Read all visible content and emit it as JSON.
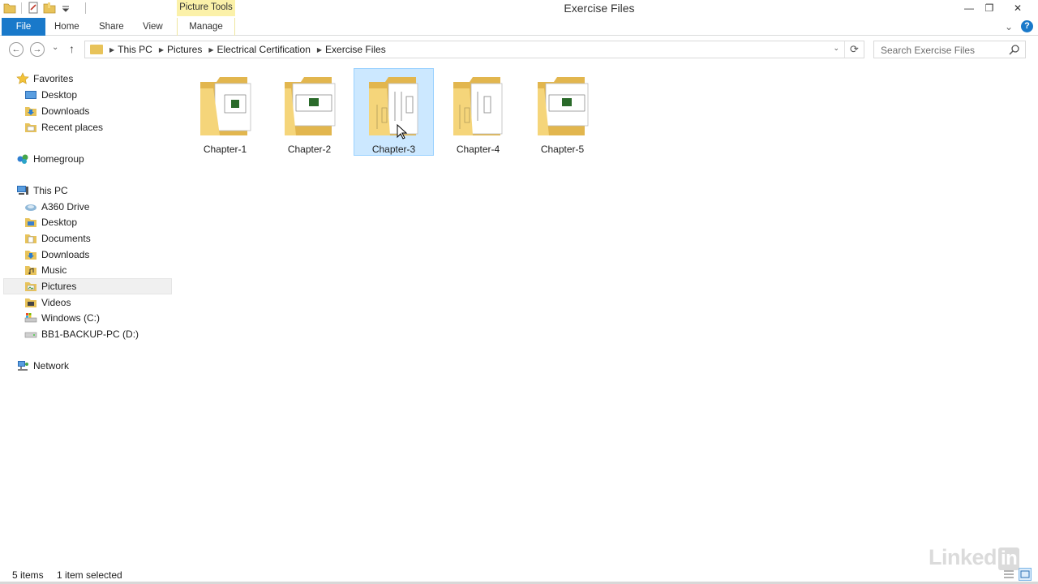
{
  "window": {
    "title": "Exercise Files",
    "context_tab": "Picture Tools",
    "minimize_glyph": "—",
    "restore_glyph": "❐",
    "close_glyph": "✕"
  },
  "ribbon": {
    "tabs": [
      "File",
      "Home",
      "Share",
      "View",
      "Manage"
    ],
    "help_label": "?",
    "expand_glyph": "⌄"
  },
  "nav": {
    "back_glyph": "←",
    "forward_glyph": "→",
    "recent_glyph": "⌄",
    "up_glyph": "↑",
    "breadcrumb": [
      "This PC",
      "Pictures",
      "Electrical Certification",
      "Exercise Files"
    ],
    "dropdown_glyph": "⌄",
    "refresh_glyph": "⟳",
    "search_placeholder": "Search Exercise Files"
  },
  "sidebar": {
    "favorites": {
      "label": "Favorites",
      "items": [
        "Desktop",
        "Downloads",
        "Recent places"
      ]
    },
    "homegroup": {
      "label": "Homegroup"
    },
    "this_pc": {
      "label": "This PC",
      "items": [
        "A360 Drive",
        "Desktop",
        "Documents",
        "Downloads",
        "Music",
        "Pictures",
        "Videos",
        "Windows (C:)",
        "BB1-BACKUP-PC (D:)"
      ],
      "selected": "Pictures"
    },
    "network": {
      "label": "Network"
    }
  },
  "content": {
    "folders": [
      "Chapter-1",
      "Chapter-2",
      "Chapter-3",
      "Chapter-4",
      "Chapter-5"
    ],
    "selected": "Chapter-3"
  },
  "status": {
    "item_count": "5 items",
    "selection": "1 item selected"
  },
  "watermark": {
    "text": "Linked",
    "suffix": "in"
  },
  "colors": {
    "file_tab": "#1979ca",
    "context_tab": "#fbf1a9",
    "selection_bg": "#cce8ff",
    "selection_border": "#99d1ff",
    "folder": "#e8c35a"
  }
}
